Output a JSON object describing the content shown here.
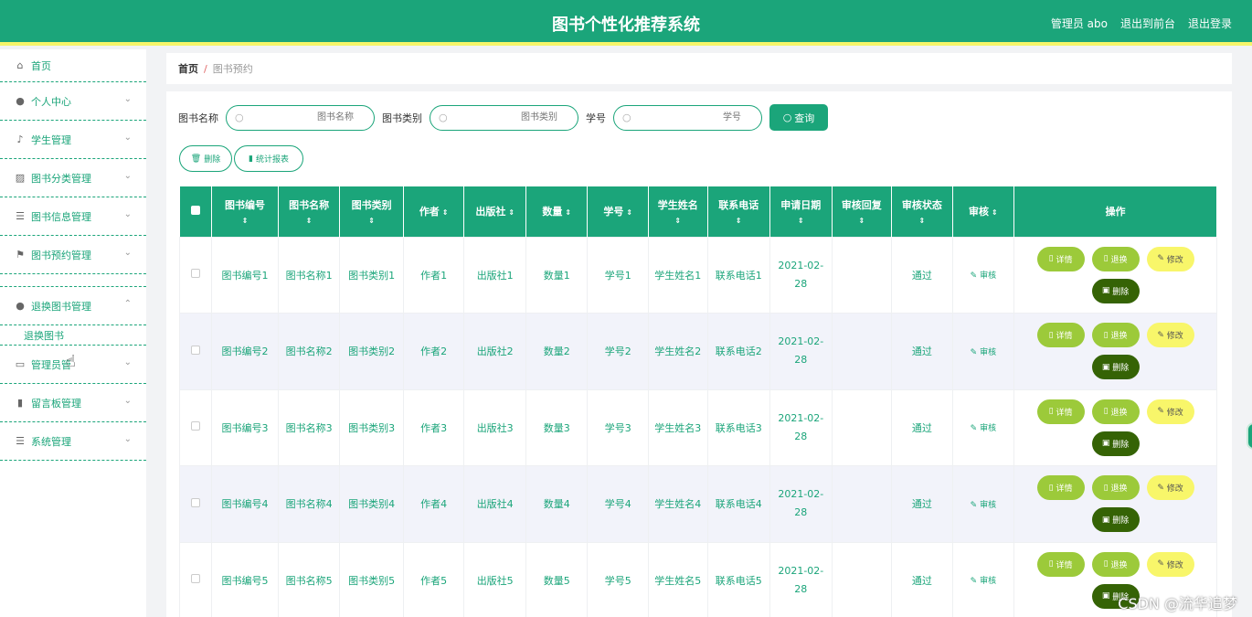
{
  "header": {
    "title": "图书个性化推荐系统",
    "links": [
      "管理员 abo",
      "退出到前台",
      "退出登录"
    ]
  },
  "sidebar": {
    "items": [
      {
        "label": "首页",
        "icon": "home-icon"
      },
      {
        "label": "个人中心",
        "icon": "user-icon"
      },
      {
        "label": "学生管理",
        "icon": "mic-icon"
      },
      {
        "label": "图书分类管理",
        "icon": "chart-icon"
      },
      {
        "label": "图书信息管理",
        "icon": "list-icon"
      },
      {
        "label": "图书预约管理",
        "icon": "flag-icon"
      },
      {
        "label": "退换图书管理",
        "icon": "user-icon"
      },
      {
        "label": "退换图书"
      },
      {
        "label": "管理员管",
        "icon": "monitor-icon"
      },
      {
        "label": "留言板管理",
        "icon": "bar-chart-icon"
      },
      {
        "label": "系统管理",
        "icon": "list-icon"
      }
    ]
  },
  "breadcrumb": {
    "home": "首页",
    "sep": "/",
    "current": "图书预约"
  },
  "search": {
    "name_label": "图书名称",
    "name_placeholder": "图书名称",
    "type_label": "图书类别",
    "type_placeholder": "图书类别",
    "id_label": "学号",
    "id_placeholder": "学号",
    "query_label": "查询"
  },
  "actions": {
    "delete_label": "删除",
    "report_label": "统计报表"
  },
  "table": {
    "headers": [
      "图书编号",
      "图书名称",
      "图书类别",
      "作者",
      "出版社",
      "数量",
      "学号",
      "学生姓名",
      "联系电话",
      "申请日期",
      "审核回复",
      "审核状态",
      "审核",
      "操作"
    ],
    "rows": [
      [
        "图书编号1",
        "图书名称1",
        "图书类别1",
        "作者1",
        "出版社1",
        "数量1",
        "学号1",
        "学生姓名1",
        "联系电话1",
        "2021-02-28",
        "",
        "通过"
      ],
      [
        "图书编号2",
        "图书名称2",
        "图书类别2",
        "作者2",
        "出版社2",
        "数量2",
        "学号2",
        "学生姓名2",
        "联系电话2",
        "2021-02-28",
        "",
        "通过"
      ],
      [
        "图书编号3",
        "图书名称3",
        "图书类别3",
        "作者3",
        "出版社3",
        "数量3",
        "学号3",
        "学生姓名3",
        "联系电话3",
        "2021-02-28",
        "",
        "通过"
      ],
      [
        "图书编号4",
        "图书名称4",
        "图书类别4",
        "作者4",
        "出版社4",
        "数量4",
        "学号4",
        "学生姓名4",
        "联系电话4",
        "2021-02-28",
        "",
        "通过"
      ],
      [
        "图书编号5",
        "图书名称5",
        "图书类别5",
        "作者5",
        "出版社5",
        "数量5",
        "学号5",
        "学生姓名5",
        "联系电话5",
        "2021-02-28",
        "",
        "通过"
      ]
    ],
    "audit_label": "审核",
    "op_labels": {
      "detail": "详情",
      "return": "退换",
      "edit": "修改",
      "delete": "删除"
    }
  },
  "watermark": "CSDN @流华追梦",
  "colors": {
    "primary": "#1ba57a",
    "accent_bar": "#f6f56a",
    "op_green": "#9cca3a",
    "op_yellow": "#f8f66a",
    "op_dark": "#356305"
  }
}
